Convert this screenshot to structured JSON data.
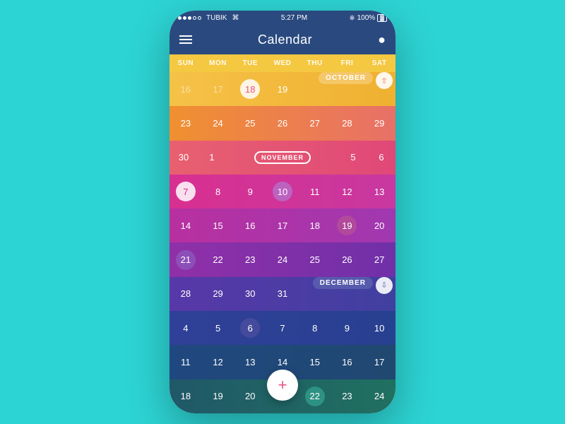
{
  "statusBar": {
    "carrier": "TUBIK",
    "time": "5:27 PM",
    "battery": "100%"
  },
  "header": {
    "title": "Calendar",
    "menu_label": "Menu",
    "search_label": "Search"
  },
  "dayHeaders": [
    "SUN",
    "MON",
    "TUE",
    "WED",
    "THU",
    "FRI",
    "SAT"
  ],
  "months": {
    "october": "OCTOBER",
    "november": "NOVEMBER",
    "december": "DECEMBER"
  },
  "fab": {
    "label": "+"
  },
  "rows": [
    {
      "cells": [
        "16",
        "17",
        "18",
        "19",
        "",
        "",
        ""
      ],
      "special": "october-row",
      "showMonthLabel": true,
      "monthLabel": "OCTOBER",
      "chevron": "up"
    },
    {
      "cells": [
        "23",
        "24",
        "25",
        "26",
        "27",
        "28",
        "29"
      ]
    },
    {
      "cells": [
        "30",
        "1",
        "",
        "",
        "",
        "5",
        "6"
      ],
      "special": "november-row",
      "showMonthLabel": true,
      "monthLabel": "NOVEMBER"
    },
    {
      "cells": [
        "7",
        "8",
        "9",
        "10",
        "11",
        "12",
        "13"
      ]
    },
    {
      "cells": [
        "14",
        "15",
        "16",
        "17",
        "18",
        "19",
        "20"
      ]
    },
    {
      "cells": [
        "21",
        "22",
        "23",
        "24",
        "25",
        "26",
        "27"
      ]
    },
    {
      "cells": [
        "28",
        "29",
        "30",
        "31",
        "",
        "",
        ""
      ],
      "special": "december-row",
      "showMonthLabel": true,
      "monthLabel": "DECEMBER",
      "chevron": "down"
    },
    {
      "cells": [
        "4",
        "5",
        "6",
        "7",
        "8",
        "9",
        "10"
      ]
    },
    {
      "cells": [
        "11",
        "12",
        "13",
        "14",
        "15",
        "16",
        "17"
      ]
    },
    {
      "cells": [
        "18",
        "19",
        "20",
        "",
        "22",
        "23",
        "24"
      ]
    }
  ]
}
